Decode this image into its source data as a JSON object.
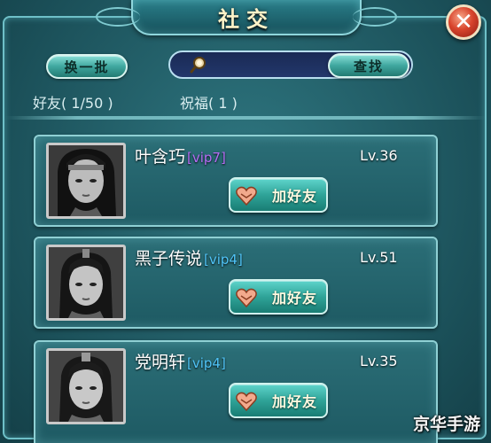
{
  "window": {
    "title": "社交",
    "close_glyph": "✕"
  },
  "toolbar": {
    "refresh_label": "换一批",
    "search_placeholder": "",
    "search_button_label": "查找"
  },
  "stats": {
    "friends_label": "好友",
    "friends_count": "( 1/50 )",
    "blessing_label": "祝福",
    "blessing_count": "( 1 )"
  },
  "friends": [
    {
      "name": "叶含巧",
      "vip": "[vip7]",
      "level": "Lv.36",
      "add_label": "加好友",
      "avatar": "female-portrait",
      "vip_color": "#b56cf4"
    },
    {
      "name": "黑子传说",
      "vip": "[vip4]",
      "level": "Lv.51",
      "add_label": "加好友",
      "avatar": "male-portrait",
      "vip_color": "#4fc3f7"
    },
    {
      "name": "党明轩",
      "vip": "[vip4]",
      "level": "Lv.35",
      "add_label": "加好友",
      "avatar": "male-portrait",
      "vip_color": "#4fc3f7"
    }
  ],
  "watermark": "京华手游",
  "colors": {
    "panel": "#1f5a63",
    "accent": "#8fd0d4",
    "close": "#d8442c"
  }
}
